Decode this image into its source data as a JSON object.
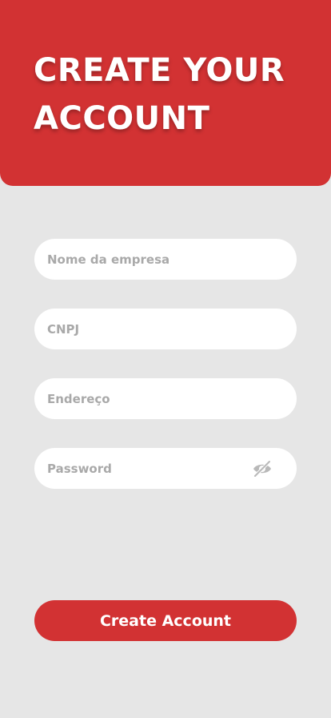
{
  "header": {
    "title_line1": "CREATE YOUR",
    "title_line2": "ACCOUNT",
    "background_color": "#d23233"
  },
  "form": {
    "company_name": {
      "placeholder": "Nome da empresa",
      "value": ""
    },
    "cnpj": {
      "placeholder": "CNPJ",
      "value": ""
    },
    "address": {
      "placeholder": "Endereço",
      "value": ""
    },
    "password": {
      "placeholder": "Password",
      "value": "",
      "toggle_icon": "eye-off-icon"
    }
  },
  "submit": {
    "label": "Create Account"
  },
  "colors": {
    "accent": "#d23233",
    "page_background": "#e6e6e6",
    "field_background": "#ffffff",
    "placeholder_text": "#a9a9a9"
  }
}
